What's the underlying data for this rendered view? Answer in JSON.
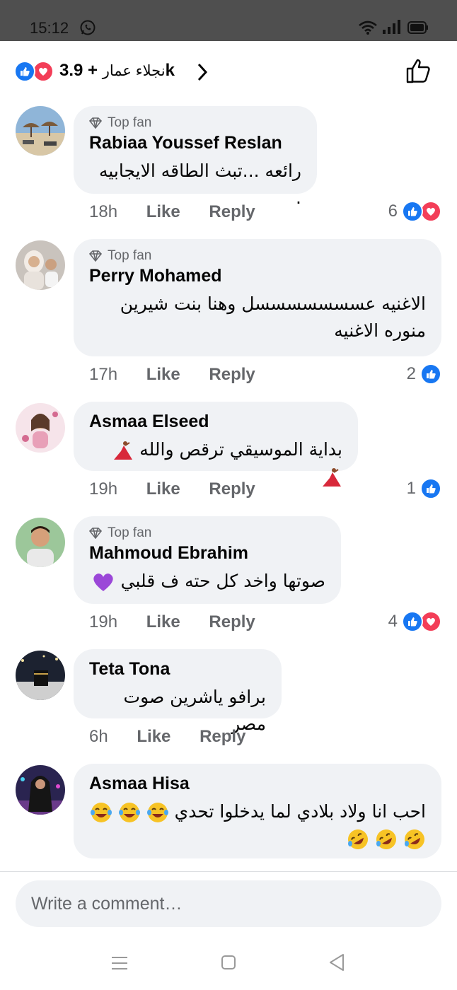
{
  "status_bar": {
    "time": "15:12"
  },
  "reactions_header": {
    "summary": "+ 3.9k",
    "name": "نجلاء عمار"
  },
  "comments": [
    {
      "author": "Rabiaa Youssef Reslan",
      "badge": "Top fan",
      "text": "رائعه ...تبث الطاقه الايجابيه .",
      "time": "18h",
      "like_label": "Like",
      "reply_label": "Reply",
      "reaction_count": "6",
      "reactions": [
        "like-icon",
        "love-icon"
      ]
    },
    {
      "author": "Perry Mohamed",
      "badge": "Top fan",
      "text": "الاغنيه عسسسسسسسل وهنا بنت شيرين منوره الاغنيه",
      "time": "17h",
      "like_label": "Like",
      "reply_label": "Reply",
      "reaction_count": "2",
      "reactions": [
        "like-icon"
      ]
    },
    {
      "author": "Asmaa Elseed",
      "text": "بداية الموسيقي ترقص والله",
      "time": "19h",
      "like_label": "Like",
      "reply_label": "Reply",
      "reaction_count": "1",
      "reactions": [
        "like-icon"
      ]
    },
    {
      "author": "Mahmoud Ebrahim",
      "badge": "Top fan",
      "text": "صوتها واخد كل حته ف قلبي",
      "time": "19h",
      "like_label": "Like",
      "reply_label": "Reply",
      "reaction_count": "4",
      "reactions": [
        "like-icon",
        "love-icon"
      ]
    },
    {
      "author": "Teta Tona",
      "text": "برافو ياشرين صوت مصر",
      "time": "6h",
      "like_label": "Like",
      "reply_label": "Reply"
    },
    {
      "author": "Asmaa Hisa",
      "text": "احب انا ولاد بلادي لما يدخلوا تحدي"
    }
  ],
  "composer": {
    "placeholder": "Write a comment…"
  },
  "colors": {
    "accent": "#1877f2",
    "love": "#f33e58",
    "bubble": "#f0f2f5",
    "muted": "#65676b"
  }
}
